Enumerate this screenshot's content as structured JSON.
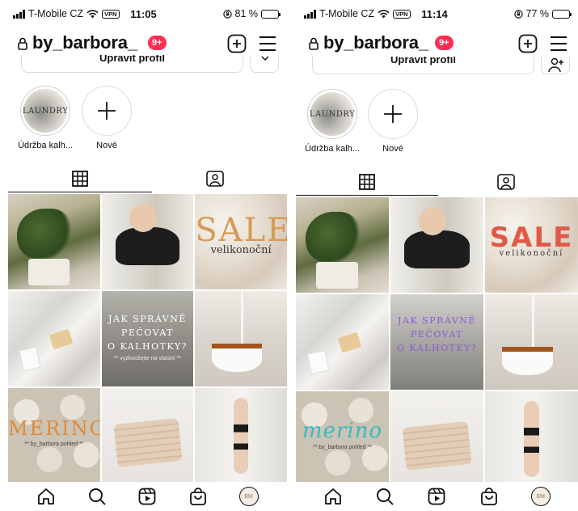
{
  "colors": {
    "badge": "#ff2e51",
    "text": "#111111",
    "border": "#dbdbdb"
  },
  "left": {
    "status": {
      "carrier": "T-Mobile CZ",
      "vpn": "VPN",
      "time": "11:05",
      "battery": "81 %",
      "battery_level": 0.81
    },
    "header": {
      "username": "by_barbora_",
      "badge": "9+"
    },
    "edit_profile": "Upravit profil",
    "highlights": [
      {
        "label": "Údržba kalh...",
        "cover_text": "LAUNDRY"
      },
      {
        "label": "Nové"
      }
    ],
    "tiles": {
      "sale": "SALE",
      "sale_sub": "velikonoční",
      "quote_lines": [
        "JAK SPRÁVNĚ",
        "PEČOVAT",
        "O KALHOTKY?"
      ],
      "quote_caption": "** vyzkoušejte na vlastní **",
      "merino": "MERINO",
      "merino_caption": "** by_barbora pohled **"
    }
  },
  "right": {
    "status": {
      "carrier": "T-Mobile CZ",
      "vpn": "VPN",
      "time": "11:14",
      "battery": "77 %",
      "battery_level": 0.77
    },
    "header": {
      "username": "by_barbora_",
      "badge": "9+"
    },
    "edit_profile": "Upravit profil",
    "highlights": [
      {
        "label": "Údržba kalh...",
        "cover_text": "LAUNDRY"
      },
      {
        "label": "Nové"
      }
    ],
    "tiles": {
      "sale": "SALE",
      "sale_sub": "velikonoční",
      "quote_lines": [
        "JAK SPRÁVNĚ",
        "PEČOVAT",
        "O KALHOTKY?"
      ],
      "merino": "merino",
      "merino_caption": "** by_barbora pohled **"
    }
  },
  "nav_avatar_text": "BM"
}
